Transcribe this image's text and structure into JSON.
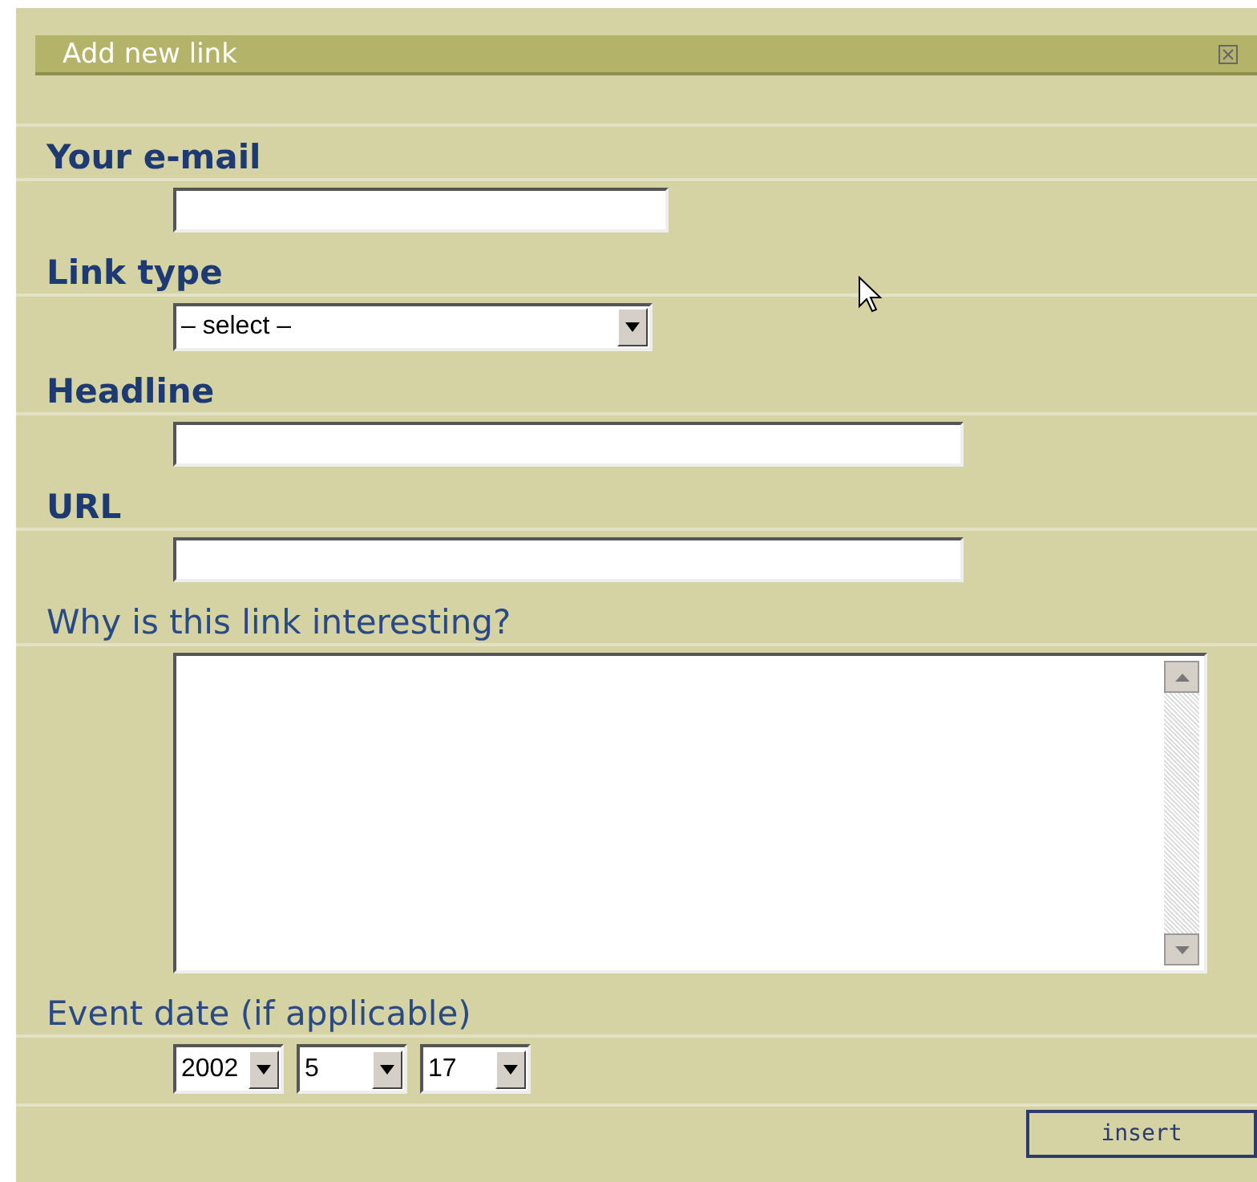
{
  "dialog": {
    "title": "Add new link"
  },
  "fields": [
    {
      "label": "Your e-mail",
      "strong": true,
      "kind": "short"
    },
    {
      "label": "Link type",
      "strong": true,
      "kind": "select",
      "value": "– select –"
    },
    {
      "label": "Headline",
      "strong": true,
      "kind": "long"
    },
    {
      "label": "URL",
      "strong": true,
      "kind": "long"
    },
    {
      "label": "Why is this link interesting?",
      "strong": false,
      "kind": "textarea"
    },
    {
      "label": "Event date (if applicable)",
      "strong": false,
      "kind": "date",
      "parts": [
        "2002",
        "5",
        "17"
      ]
    }
  ],
  "buttons": [
    {
      "label": "insert"
    }
  ]
}
